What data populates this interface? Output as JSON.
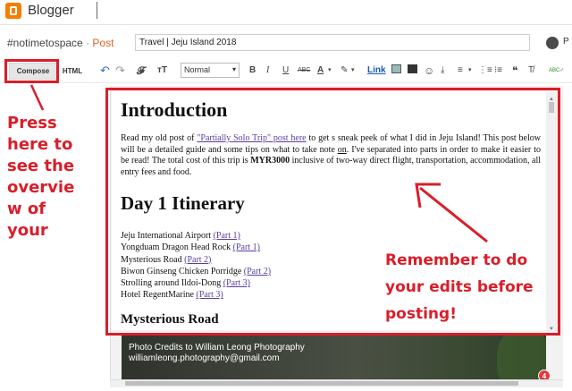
{
  "app": {
    "name": "Blogger"
  },
  "header": {
    "blog_name": "#notimetospace",
    "separator": "·",
    "post_label": "Post",
    "title_value": "Travel | Jeju Island 2018",
    "avatar_letter": "P"
  },
  "toolbar": {
    "compose_label": "Compose",
    "html_label": "HTML",
    "undo_icon": "↶",
    "redo_icon": "↷",
    "font_icon": "𝓕",
    "size_icon": "ᴛT",
    "format_value": "Normal",
    "bold": "B",
    "italic": "I",
    "underline": "U",
    "strike": "ABC",
    "text_color": "A",
    "highlight": "✎",
    "link_label": "Link",
    "emoji_icon": "☺",
    "jump_icon": "⤓",
    "align_icon": "≡",
    "numbered_list_icon": "⋮≡",
    "bullet_list_icon": "⁝≡",
    "quote_icon": "❝",
    "clear_icon": "T̸",
    "spellcheck_icon": "ABC✓"
  },
  "document": {
    "heading_intro": "Introduction",
    "para_pre": "Read my old post of ",
    "para_link": "\"Partially Solo Trip\" post here",
    "para_mid": " to get s sneak peek of what I did in Jeju Island! This post below will be a detailed guide and some tips on what to take note ",
    "para_on": "on",
    "para_mid2": ". I've separated into parts in order to make it easier to be read! The total cost of this trip is ",
    "para_bold": "MYR3000",
    "para_end": " inclusive of two-way direct flight, transportation, accommodation, all entry fees and food.",
    "heading_day1": "Day 1 Itinerary",
    "itinerary": [
      {
        "text": "Jeju International Airport ",
        "link": "(Part 1)"
      },
      {
        "text": "Yongduam Dragon Head Rock ",
        "link": "(Part 1)"
      },
      {
        "text": "Mysterious Road ",
        "link": "(Part 2)"
      },
      {
        "text": "Biwon Ginseng Chicken Porridge ",
        "link": "(Part 2)"
      },
      {
        "text": "Strolling around Ildoi-Dong ",
        "link": "(Part 3)"
      },
      {
        "text": "Hotel RegentMarine ",
        "link": "(Part 3)"
      }
    ],
    "heading_mysterious": "Mysterious Road"
  },
  "photo": {
    "credit_line1": "Photo Credits to William Leong Photography",
    "credit_line2": "williamleong.photography@gmail.com"
  },
  "badge_count": "4",
  "annotations": {
    "left_text": "Press here to see the overvie w of your",
    "right_text": "Remember to do your edits before posting!",
    "color": "#d91e2a"
  }
}
